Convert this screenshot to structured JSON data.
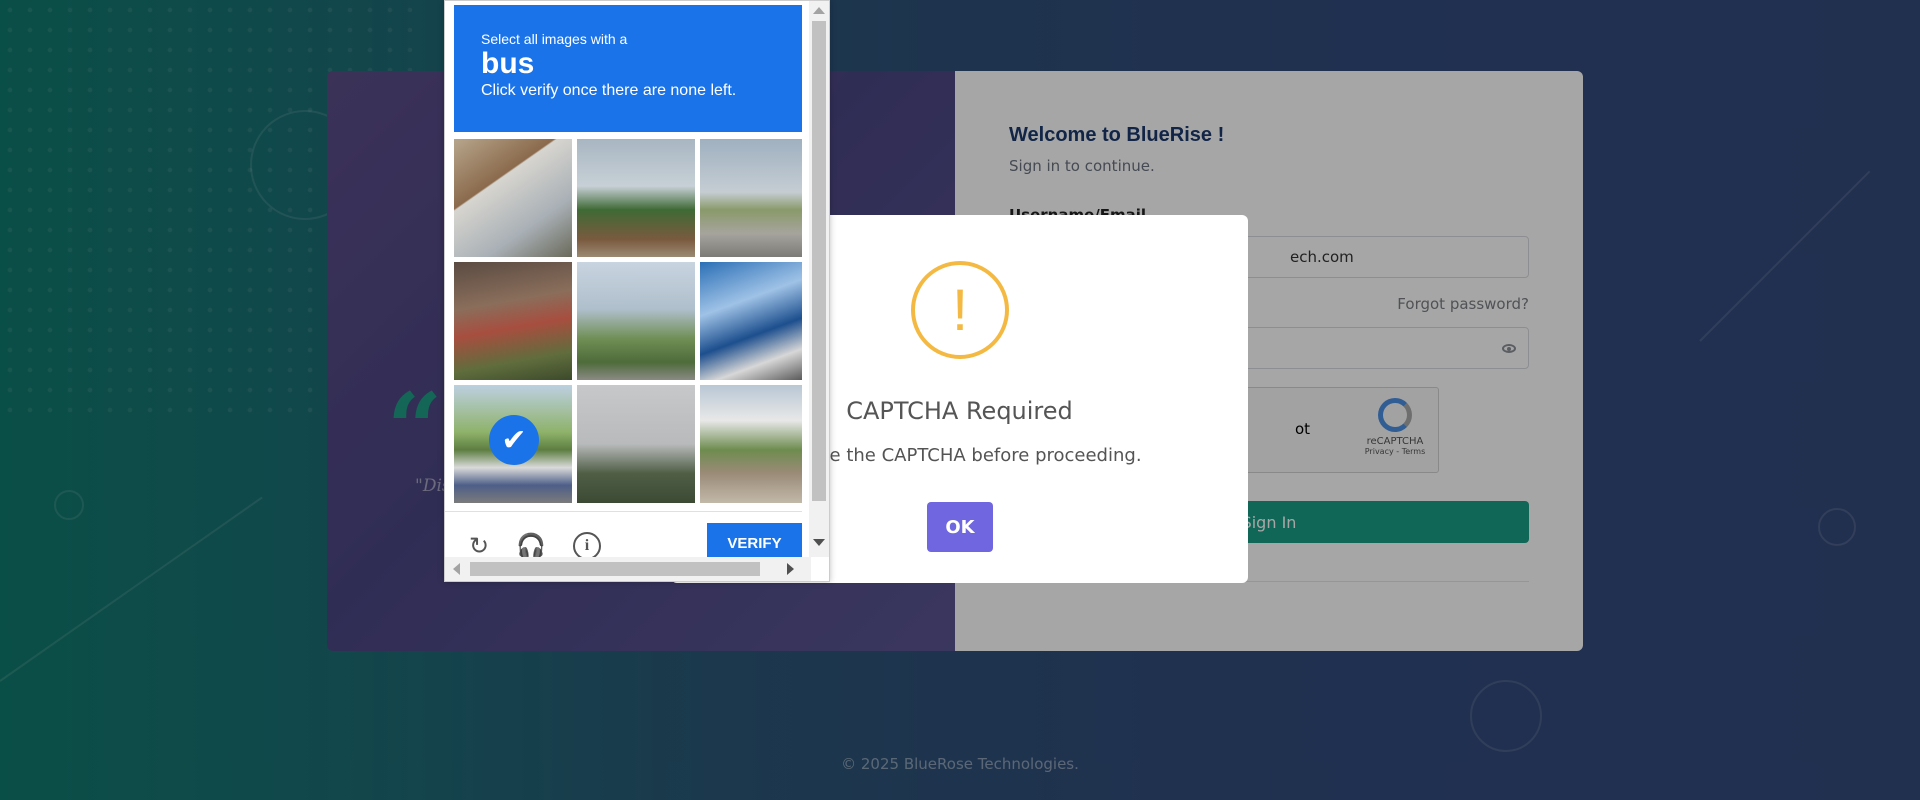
{
  "login": {
    "welcome": "Welcome to BlueRise !",
    "subtitle": "Sign in to continue.",
    "username_label": "Username/Email",
    "username_value_visible": "ech.com",
    "forgot_password": "Forgot password?",
    "recaptcha_label_visible": "ot",
    "recaptcha_brand": "reCAPTCHA",
    "recaptcha_terms": "Privacy - Terms",
    "signin_label": "Sign In",
    "quote_visible": "\"Dis"
  },
  "footer": {
    "copyright": "© 2025 BlueRose Technologies."
  },
  "modal": {
    "icon": "!",
    "title": "CAPTCHA Required",
    "text": "mplete the CAPTCHA before proceeding.",
    "ok_label": "OK",
    "colors": {
      "warning": "#f4b942",
      "ok_button": "#7066e0"
    }
  },
  "challenge": {
    "instruction_top": "Select all images with a",
    "target": "bus",
    "instruction_bottom": "Click verify once there are none left.",
    "verify_label": "VERIFY",
    "selected_tiles": [
      6
    ],
    "colors": {
      "header": "#1a73e8"
    }
  },
  "icons": {
    "refresh": "↻",
    "audio": "🎧",
    "info": "i",
    "checkmark": "✔"
  },
  "theme": {
    "primary_teal": "#199e86",
    "title_blue": "#1d3a6e"
  }
}
